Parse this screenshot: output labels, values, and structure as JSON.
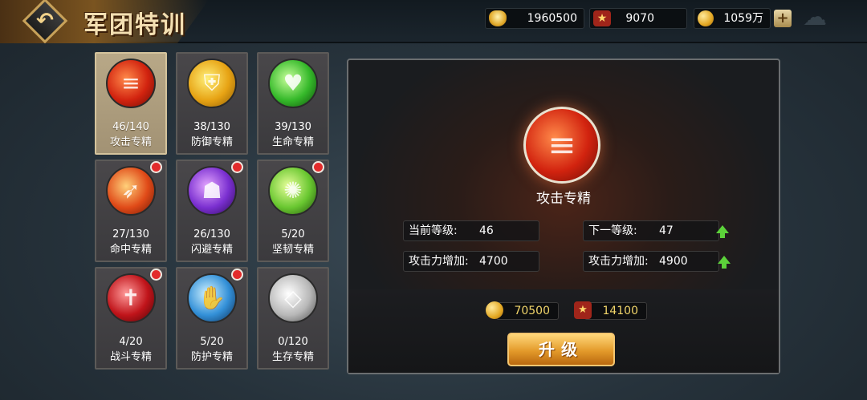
{
  "header": {
    "title": "军团特训",
    "back_icon": "back-arrow-icon",
    "resources": [
      {
        "icon": "gold-ingot-icon",
        "value": "1960500"
      },
      {
        "icon": "star-medal-icon",
        "value": "9070"
      },
      {
        "icon": "gold-coin-icon",
        "value": "1059万"
      }
    ],
    "add_label": "+"
  },
  "skills": [
    {
      "progress": "46/140",
      "name": "攻击专精",
      "color": "#d2230f",
      "icon": "attack-icon",
      "selected": true,
      "notify": false
    },
    {
      "progress": "38/130",
      "name": "防御专精",
      "color": "#e7a314",
      "icon": "shield-icon",
      "selected": false,
      "notify": false
    },
    {
      "progress": "39/130",
      "name": "生命专精",
      "color": "#35b92a",
      "icon": "heart-icon",
      "selected": false,
      "notify": false
    },
    {
      "progress": "27/130",
      "name": "命中专精",
      "color": "#e04a18",
      "icon": "arrow-icon",
      "selected": false,
      "notify": true
    },
    {
      "progress": "26/130",
      "name": "闪避专精",
      "color": "#7a2fd0",
      "icon": "dodge-icon",
      "selected": false,
      "notify": true
    },
    {
      "progress": "5/20",
      "name": "坚韧专精",
      "color": "#69c730",
      "icon": "tenacity-icon",
      "selected": false,
      "notify": true
    },
    {
      "progress": "4/20",
      "name": "战斗专精",
      "color": "#c0141a",
      "icon": "combat-icon",
      "selected": false,
      "notify": true
    },
    {
      "progress": "5/20",
      "name": "防护专精",
      "color": "#3390d8",
      "icon": "hand-icon",
      "selected": false,
      "notify": true
    },
    {
      "progress": "0/120",
      "name": "生存专精",
      "color": "#b8b8b8",
      "icon": "survival-icon",
      "selected": false,
      "notify": false
    }
  ],
  "detail": {
    "title": "攻击专精",
    "current_level_label": "当前等级:",
    "current_level": "46",
    "next_level_label": "下一等级:",
    "next_level": "47",
    "current_attack_label": "攻击力增加:",
    "current_attack": "4700",
    "next_attack_label": "攻击力增加:",
    "next_attack": "4900",
    "cost_gold": "70500",
    "cost_star": "14100",
    "upgrade_label": "升级"
  }
}
